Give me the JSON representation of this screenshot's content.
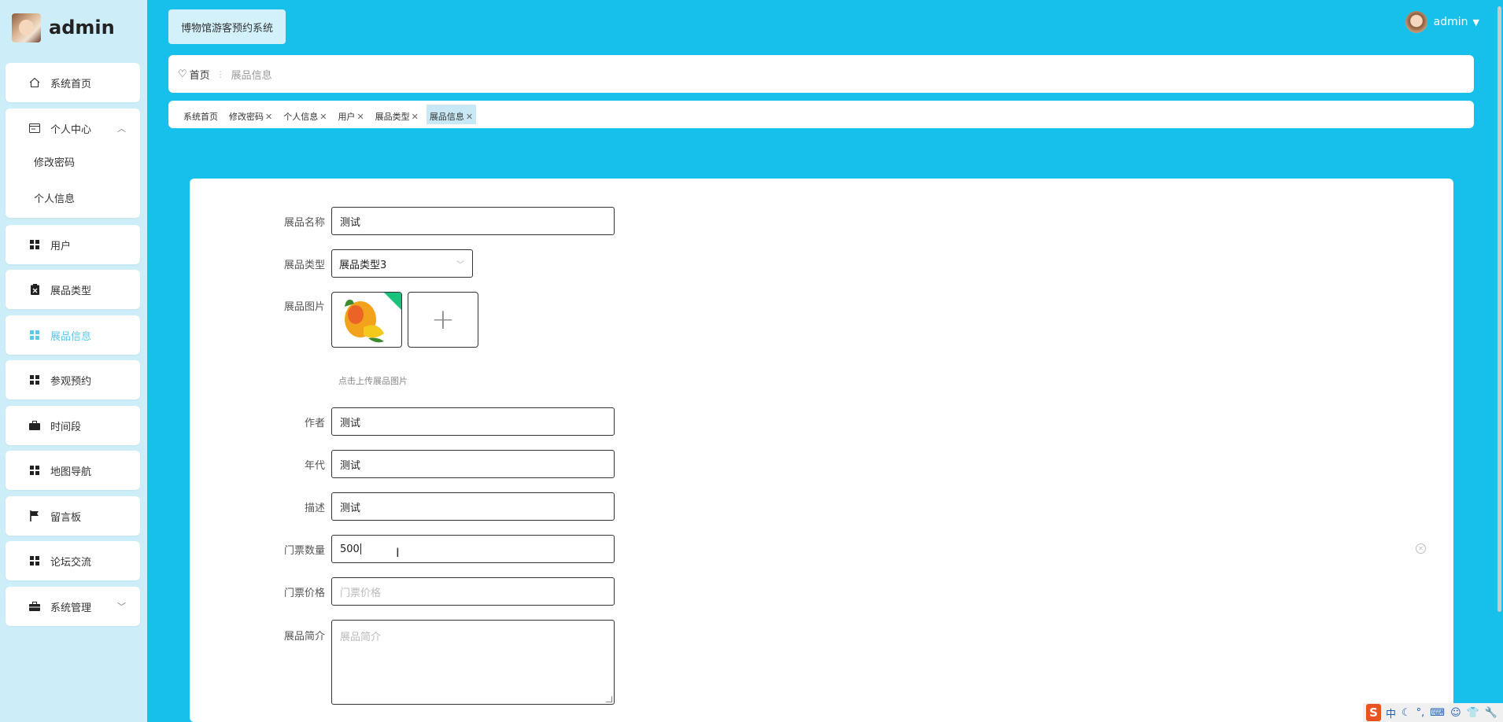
{
  "brand": {
    "title": "admin"
  },
  "sidebar": {
    "home": "系统首页",
    "personal": "个人中心",
    "personal_sub": [
      "修改密码",
      "个人信息"
    ],
    "items": [
      {
        "label": "用户",
        "icon": "grid-icon"
      },
      {
        "label": "展品类型",
        "icon": "clipboard-icon"
      },
      {
        "label": "展品信息",
        "icon": "grid-icon",
        "active": true
      },
      {
        "label": "参观预约",
        "icon": "grid-icon"
      },
      {
        "label": "时间段",
        "icon": "briefcase-icon"
      },
      {
        "label": "地图导航",
        "icon": "grid-icon"
      },
      {
        "label": "留言板",
        "icon": "flag-icon"
      },
      {
        "label": "论坛交流",
        "icon": "grid-icon"
      }
    ],
    "system": "系统管理",
    "active_color": "#5bc8ea"
  },
  "header": {
    "system_title": "博物馆游客预约系统",
    "username": "admin"
  },
  "breadcrumb": {
    "home": "首页",
    "current": "展品信息"
  },
  "tags": [
    {
      "label": "系统首页",
      "closable": false
    },
    {
      "label": "修改密码",
      "closable": true
    },
    {
      "label": "个人信息",
      "closable": true
    },
    {
      "label": "用户",
      "closable": true
    },
    {
      "label": "展品类型",
      "closable": true
    },
    {
      "label": "展品信息",
      "closable": true,
      "active": true
    }
  ],
  "form": {
    "name": {
      "label": "展品名称",
      "value": "测试"
    },
    "type": {
      "label": "展品类型",
      "value": "展品类型3"
    },
    "image": {
      "label": "展品图片",
      "tip": "点击上传展品图片"
    },
    "author": {
      "label": "作者",
      "value": "测试"
    },
    "era": {
      "label": "年代",
      "value": "测试"
    },
    "desc": {
      "label": "描述",
      "value": "测试"
    },
    "tickets": {
      "label": "门票数量",
      "value": "500"
    },
    "price": {
      "label": "门票价格",
      "placeholder": "门票价格"
    },
    "intro": {
      "label": "展品简介",
      "placeholder": "展品简介"
    }
  },
  "tray": {
    "logo": "S",
    "ime": "中"
  },
  "colors": {
    "background": "#16c0eb",
    "sidebar": "#cdeef9",
    "accent": "#5bc8ea"
  }
}
